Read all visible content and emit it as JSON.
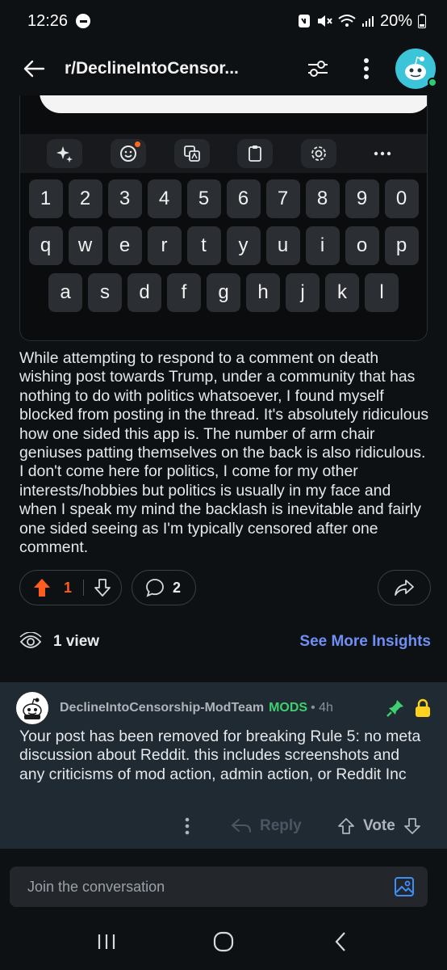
{
  "status_bar": {
    "time": "12:26",
    "battery": "20%"
  },
  "app_bar": {
    "title": "r/DeclineIntoCensor..."
  },
  "keyboard_image": {
    "number_row": [
      "1",
      "2",
      "3",
      "4",
      "5",
      "6",
      "7",
      "8",
      "9",
      "0"
    ],
    "row_1": [
      "q",
      "w",
      "e",
      "r",
      "t",
      "y",
      "u",
      "i",
      "o",
      "p"
    ],
    "row_2": [
      "a",
      "s",
      "d",
      "f",
      "g",
      "h",
      "j",
      "k",
      "l"
    ],
    "toolbar_icons": [
      "sparkle-icon",
      "emoji-icon",
      "translate-icon",
      "clipboard-icon",
      "settings-icon",
      "more-icon"
    ]
  },
  "post": {
    "body": "While attempting to respond to a comment on death wishing post towards Trump, under a community that has nothing to do with politics whatsoever, I found myself blocked from posting in the thread. It's absolutely ridiculous how one sided this app is. The number of arm chair geniuses patting themselves on the back is also ridiculous. I don't come here for politics, I come for my other interests/hobbies but politics is usually in my face and when I speak my mind the backlash is inevitable and fairly one sided seeing as I'm typically censored after one comment.",
    "upvotes": "1",
    "comments": "2",
    "views": "1 view",
    "see_more": "See More Insights"
  },
  "mod_comment": {
    "author": "DeclineIntoCensorship-ModTeam",
    "flair": "MODS",
    "time": "• 4h",
    "text": "Your post has been removed for breaking Rule 5: no meta discussion about Reddit. this includes screenshots and any criticisms of mod action, admin action, or Reddit Inc",
    "reply_label": "Reply",
    "vote_label": "Vote"
  },
  "composer": {
    "placeholder": "Join the conversation"
  },
  "colors": {
    "background": "#0e1113",
    "upvote_active": "#ff5c1f",
    "link_blue": "#6f8ff5",
    "mod_green": "#3fcf6e",
    "comment_bg": "#1f2a33",
    "lock_yellow": "#ffd21f"
  }
}
